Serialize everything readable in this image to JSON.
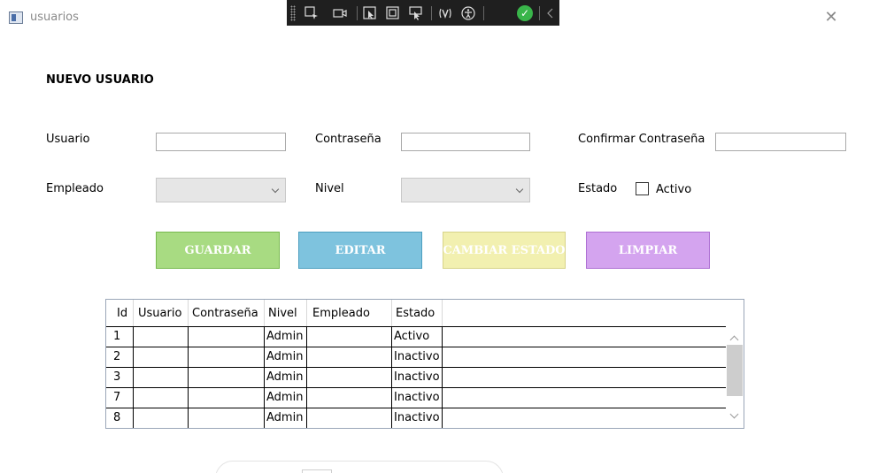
{
  "window": {
    "title": "usuarios",
    "close_glyph": "✕"
  },
  "devtools": {
    "icons": [
      "select-element-icon",
      "record-icon",
      "pointer-icon",
      "layout-icon",
      "track-focus-icon",
      "hot-reload-icon",
      "accessibility-icon",
      "status-ok-icon",
      "collapse-icon"
    ]
  },
  "form": {
    "heading": "NUEVO USUARIO",
    "usuario_label": "Usuario",
    "usuario_value": "",
    "contrasena_label": "Contraseña",
    "contrasena_value": "",
    "confirmar_label": "Confirmar Contraseña",
    "confirmar_value": "",
    "empleado_label": "Empleado",
    "empleado_value": "",
    "nivel_label": "Nivel",
    "nivel_value": "",
    "estado_label": "Estado",
    "activo_label": "Activo",
    "activo_checked": false
  },
  "buttons": {
    "guardar": "GUARDAR",
    "editar": "EDITAR",
    "cambiar_estado": "CAMBIAR ESTADO",
    "limpiar": "LIMPIAR",
    "colors": {
      "guardar": "#a8db82",
      "editar": "#7ec3de",
      "cambiar_estado": "#f2f0b0",
      "limpiar": "#d4a4ef"
    }
  },
  "table": {
    "columns": [
      "Id",
      "Usuario",
      "Contraseña",
      "Nivel",
      "Empleado",
      "Estado"
    ],
    "rows": [
      {
        "id": "1",
        "usuario": "",
        "contrasena": "",
        "nivel": "Admin",
        "empleado": "",
        "estado": "Activo"
      },
      {
        "id": "2",
        "usuario": "",
        "contrasena": "",
        "nivel": "Admin",
        "empleado": "",
        "estado": "Inactivo"
      },
      {
        "id": "3",
        "usuario": "",
        "contrasena": "",
        "nivel": "Admin",
        "empleado": "",
        "estado": "Inactivo"
      },
      {
        "id": "7",
        "usuario": "",
        "contrasena": "",
        "nivel": "Admin",
        "empleado": "",
        "estado": "Inactivo"
      },
      {
        "id": "8",
        "usuario": "",
        "contrasena": "",
        "nivel": "Admin",
        "empleado": "",
        "estado": "Inactivo"
      }
    ]
  }
}
